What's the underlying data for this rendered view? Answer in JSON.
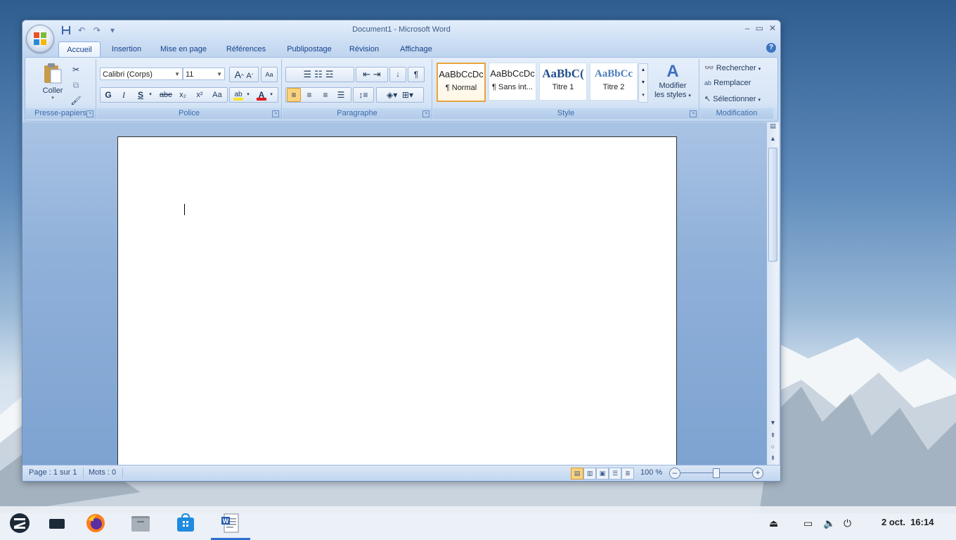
{
  "window": {
    "title": "Document1 - Microsoft Word",
    "controls": {
      "minimize": "–",
      "maximize": "▭",
      "close": "✕"
    }
  },
  "quick_access": [
    {
      "name": "save-icon",
      "glyph": "💾"
    },
    {
      "name": "undo-icon",
      "glyph": "↶"
    },
    {
      "name": "redo-icon",
      "glyph": "↷"
    },
    {
      "name": "customize-icon",
      "glyph": "▾"
    }
  ],
  "tabs": [
    "Accueil",
    "Insertion",
    "Mise en page",
    "Références",
    "Publipostage",
    "Révision",
    "Affichage"
  ],
  "active_tab": "Accueil",
  "help_icon": "?",
  "ribbon": {
    "clipboard": {
      "label": "Presse-papiers",
      "paste": "Coller"
    },
    "font": {
      "label": "Police",
      "font_name": "Calibri (Corps)",
      "font_size": "11",
      "bold": "G",
      "italic": "I",
      "underline": "S",
      "strike": "abe",
      "subscript": "x₂",
      "superscript": "x²",
      "case": "Aa",
      "highlight": "ab",
      "color": "A",
      "grow": "A",
      "shrink": "A"
    },
    "paragraph": {
      "label": "Paragraphe",
      "pilcrow": "¶"
    },
    "styles": {
      "label": "Style",
      "items": [
        {
          "preview": "AaBbCcDc",
          "name": "¶ Normal"
        },
        {
          "preview": "AaBbCcDc",
          "name": "¶ Sans int..."
        },
        {
          "preview": "AaBbC(",
          "name": "Titre 1"
        },
        {
          "preview": "AaBbCc",
          "name": "Titre 2"
        }
      ],
      "change_styles_line1": "Modifier",
      "change_styles_line2": "les styles"
    },
    "editing": {
      "label": "Modification",
      "find": "Rechercher",
      "replace": "Remplacer",
      "select": "Sélectionner"
    }
  },
  "status": {
    "page": "Page : 1 sur 1",
    "words": "Mots : 0",
    "zoom": "100 %",
    "zoom_minus": "–",
    "zoom_plus": "+"
  },
  "taskbar": {
    "clock": "16:14",
    "date": "2 oct."
  },
  "colors": {
    "accent": "#2c6fd1",
    "ribbon": "#dbe7f6",
    "highlight": "#f5e42a",
    "font_color": "#e01b1b"
  }
}
